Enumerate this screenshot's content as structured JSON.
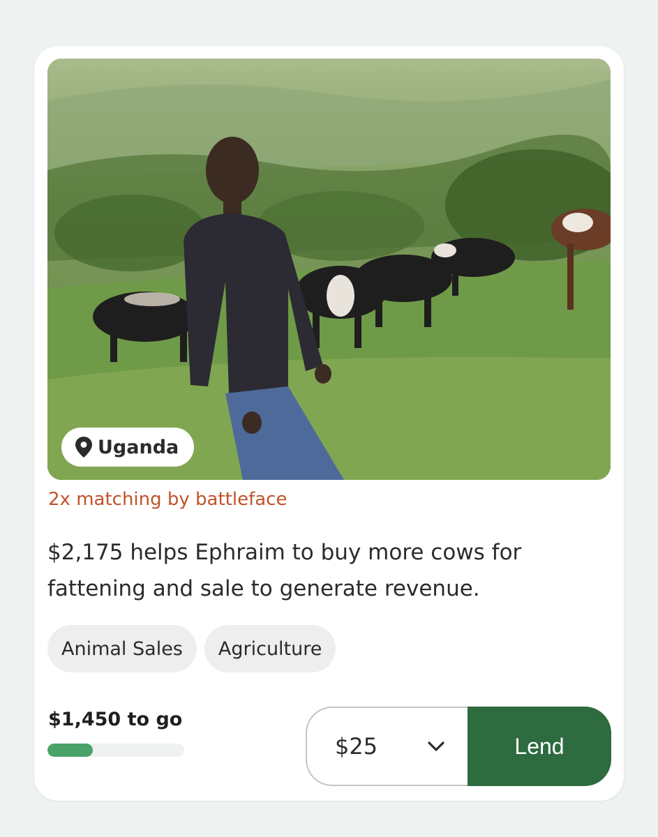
{
  "loan_card": {
    "photo_alt": "Ephraim standing on a hillside with cows grazing",
    "location": "Uganda",
    "location_icon": "map-pin-icon",
    "matching_text": "2x matching by battleface",
    "description": "$2,175 helps Ephraim to buy more cows for fattening and sale to generate revenue.",
    "tags": [
      "Animal Sales",
      "Agriculture"
    ],
    "to_go_text": "$1,450 to go",
    "progress_fraction": 0.333,
    "amount_selected": "$25",
    "amount_icon": "chevron-down-icon",
    "lend_label": "Lend"
  },
  "colors": {
    "page_background": "#eef2f0",
    "card_background": "#ffffff",
    "matching_text": "#c0532a",
    "progress_fill": "#4aa268",
    "progress_track": "#eef1ef",
    "lend_button": "#2e6b3f",
    "tag_background": "#eeeeee"
  }
}
